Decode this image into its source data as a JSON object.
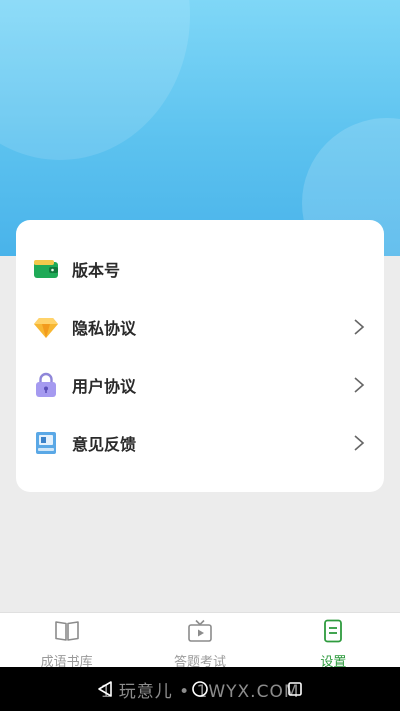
{
  "settings": {
    "items": [
      {
        "label": "版本号",
        "icon": "wallet-icon",
        "has_arrow": false
      },
      {
        "label": "隐私协议",
        "icon": "diamond-icon",
        "has_arrow": true
      },
      {
        "label": "用户协议",
        "icon": "lock-icon",
        "has_arrow": true
      },
      {
        "label": "意见反馈",
        "icon": "notebook-icon",
        "has_arrow": true
      }
    ]
  },
  "tabbar": {
    "tabs": [
      {
        "label": "成语书库",
        "icon": "book-icon",
        "active": false
      },
      {
        "label": "答题考试",
        "icon": "tv-icon",
        "active": false
      },
      {
        "label": "设置",
        "icon": "document-icon",
        "active": true
      }
    ]
  },
  "watermark": "1 玩意儿 • 1WYX.COM",
  "colors": {
    "accent": "#2e9b3e",
    "hero_top": "#7fd7f7",
    "hero_bottom": "#49b3ea"
  }
}
